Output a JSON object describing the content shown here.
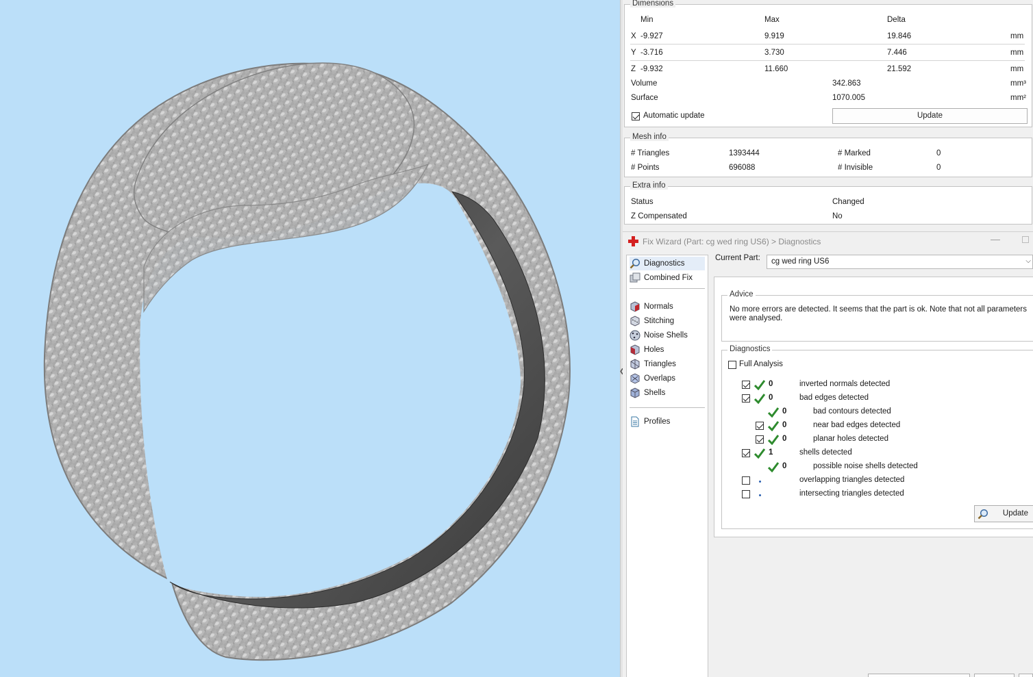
{
  "dimensions": {
    "title": "Dimensions",
    "headers": {
      "min": "Min",
      "max": "Max",
      "delta": "Delta"
    },
    "rows": [
      {
        "axis": "X",
        "min": "-9.927",
        "max": "9.919",
        "delta": "19.846",
        "unit": "mm"
      },
      {
        "axis": "Y",
        "min": "-3.716",
        "max": "3.730",
        "delta": "7.446",
        "unit": "mm"
      },
      {
        "axis": "Z",
        "min": "-9.932",
        "max": "11.660",
        "delta": "21.592",
        "unit": "mm"
      }
    ],
    "volume": {
      "label": "Volume",
      "value": "342.863",
      "unit": "mm³"
    },
    "surface": {
      "label": "Surface",
      "value": "1070.005",
      "unit": "mm²"
    },
    "auto_update": {
      "label": "Automatic update",
      "checked": true
    },
    "update_button": "Update"
  },
  "mesh_info": {
    "title": "Mesh info",
    "triangles": {
      "label": "# Triangles",
      "value": "1393444"
    },
    "points": {
      "label": "# Points",
      "value": "696088"
    },
    "marked": {
      "label": "# Marked",
      "value": "0"
    },
    "invisible": {
      "label": "# Invisible",
      "value": "0"
    }
  },
  "extra_info": {
    "title": "Extra info",
    "status": {
      "label": "Status",
      "value": "Changed"
    },
    "z_comp": {
      "label": "Z Compensated",
      "value": "No"
    }
  },
  "wizard": {
    "title": "Fix Wizard (Part: cg wed ring US6) > Diagnostics",
    "nav": [
      {
        "label": "Diagnostics",
        "icon": "magnifier-icon"
      },
      {
        "label": "Combined Fix",
        "icon": "combined-fix-icon"
      },
      {
        "label": "Normals",
        "icon": "normals-cube-icon"
      },
      {
        "label": "Stitching",
        "icon": "stitching-cube-icon"
      },
      {
        "label": "Noise Shells",
        "icon": "noise-shells-icon"
      },
      {
        "label": "Holes",
        "icon": "holes-cube-icon"
      },
      {
        "label": "Triangles",
        "icon": "triangles-cube-icon"
      },
      {
        "label": "Overlaps",
        "icon": "overlaps-cube-icon"
      },
      {
        "label": "Shells",
        "icon": "shells-cube-icon"
      },
      {
        "label": "Profiles",
        "icon": "profiles-document-icon"
      }
    ],
    "current_part_label": "Current Part:",
    "current_part_value": "cg wed ring US6",
    "advice": {
      "title": "Advice",
      "line1": "No more errors are detected. It seems that the part is ok. Note that not all parameters",
      "line2": "were analysed."
    },
    "diagnostics": {
      "title": "Diagnostics",
      "full_analysis": {
        "label": "Full Analysis",
        "checked": false
      },
      "items": [
        {
          "checked": true,
          "ok": true,
          "count": "0",
          "label": "inverted normals detected"
        },
        {
          "checked": true,
          "ok": true,
          "count": "0",
          "label": "bad edges detected"
        },
        {
          "ok": true,
          "count": "0",
          "label": "bad contours detected"
        },
        {
          "checked": true,
          "ok": true,
          "count": "0",
          "label": "near bad edges detected"
        },
        {
          "checked": true,
          "ok": true,
          "count": "0",
          "label": "planar holes detected"
        },
        {
          "checked": true,
          "ok": true,
          "count": "1",
          "label": "shells detected"
        },
        {
          "ok": true,
          "count": "0",
          "label": "possible noise shells detected"
        },
        {
          "checked": false,
          "ok": false,
          "count": "",
          "label": "overlapping triangles detected"
        },
        {
          "checked": false,
          "ok": false,
          "count": "",
          "label": "intersecting triangles detected"
        }
      ],
      "update_button": "Update"
    }
  },
  "colors": {
    "viewport_bg": "#bbdff9",
    "ok_check": "#2e8b2e",
    "wizard_cross": "#d42020"
  }
}
